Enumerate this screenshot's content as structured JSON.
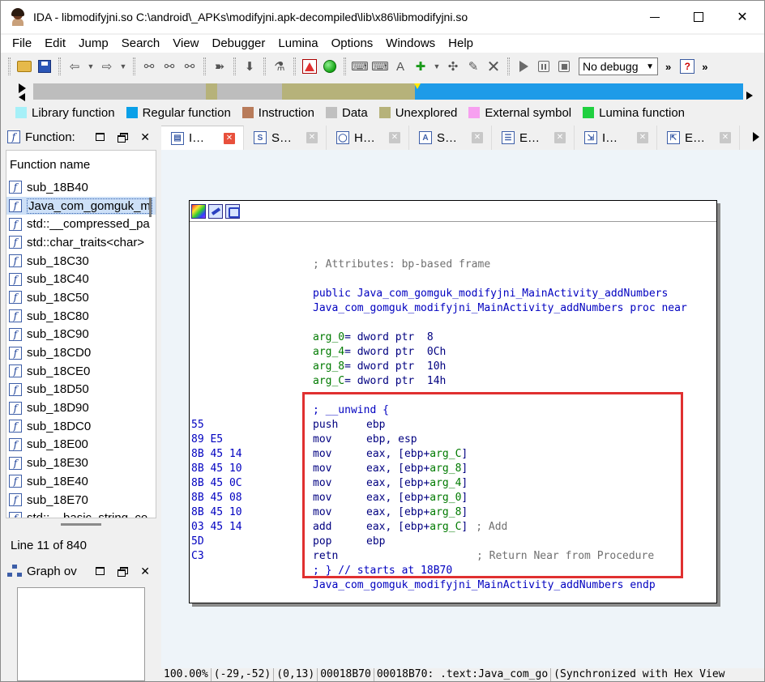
{
  "window": {
    "title": "IDA - libmodifyjni.so C:\\android\\_APKs\\modifyjni.apk-decompiled\\lib\\x86\\libmodifyjni.so",
    "controls": {
      "minimize": "",
      "maximize": "",
      "close": "✕"
    }
  },
  "menu": [
    "File",
    "Edit",
    "Jump",
    "Search",
    "View",
    "Debugger",
    "Lumina",
    "Options",
    "Windows",
    "Help"
  ],
  "toolbar": {
    "debugger_select": "No debugg",
    "more": "»"
  },
  "navband": {
    "colors": {
      "gray": "#bdbdbd",
      "olive": "#b6b27a",
      "blue": "#1e9be8"
    }
  },
  "legend": [
    {
      "label": "Library function",
      "color": "#a6f0f8"
    },
    {
      "label": "Regular function",
      "color": "#0aa0e8"
    },
    {
      "label": "Instruction",
      "color": "#b87b5a"
    },
    {
      "label": "Data",
      "color": "#c0c0c0"
    },
    {
      "label": "Unexplored",
      "color": "#b6b27a"
    },
    {
      "label": "External symbol",
      "color": "#f7a0f0"
    },
    {
      "label": "Lumina function",
      "color": "#20d040"
    }
  ],
  "functions_panel": {
    "title": "Function:",
    "column_header": "Function name",
    "items": [
      "sub_18B40",
      "Java_com_gomguk_m",
      "std::__compressed_pa",
      "std::char_traits<char>",
      "sub_18C30",
      "sub_18C40",
      "sub_18C50",
      "sub_18C80",
      "sub_18C90",
      "sub_18CD0",
      "sub_18CE0",
      "sub_18D50",
      "sub_18D90",
      "sub_18DC0",
      "sub_18E00",
      "sub_18E30",
      "sub_18E40",
      "sub_18E70",
      "std::__basic_string_co"
    ],
    "selected_index": 1,
    "line_info": "Line 11 of 840"
  },
  "graph_panel": {
    "title": "Graph ov"
  },
  "tabs": [
    {
      "label": "I…",
      "icon": "IDA",
      "active": true
    },
    {
      "label": "S…",
      "icon": "S",
      "active": false
    },
    {
      "label": "H…",
      "icon": "H",
      "active": false
    },
    {
      "label": "S…",
      "icon": "A",
      "active": false
    },
    {
      "label": "E…",
      "icon": "E",
      "active": false
    },
    {
      "label": "I…",
      "icon": "I",
      "active": false
    },
    {
      "label": "E…",
      "icon": "E",
      "active": false
    }
  ],
  "code": {
    "attributes_comment": "; Attributes: bp-based frame",
    "public_line": "public Java_com_gomguk_modifyjni_MainActivity_addNumbers",
    "proc_line": "Java_com_gomguk_modifyjni_MainActivity_addNumbers proc near",
    "args": [
      {
        "name": "arg_0",
        "def": "= dword ptr  8"
      },
      {
        "name": "arg_4",
        "def": "= dword ptr  0Ch"
      },
      {
        "name": "arg_8",
        "def": "= dword ptr  10h"
      },
      {
        "name": "arg_C",
        "def": "= dword ptr  14h"
      }
    ],
    "unwind_start": "; __unwind {",
    "instructions": [
      {
        "bytes": "55",
        "mnem": "push",
        "op1": "ebp",
        "arg": "",
        "tail": "",
        "comment": ""
      },
      {
        "bytes": "89 E5",
        "mnem": "mov",
        "op1": "ebp, esp",
        "arg": "",
        "tail": "",
        "comment": ""
      },
      {
        "bytes": "8B 45 14",
        "mnem": "mov",
        "op1": "eax, [ebp+",
        "arg": "arg_C",
        "tail": "]",
        "comment": ""
      },
      {
        "bytes": "8B 45 10",
        "mnem": "mov",
        "op1": "eax, [ebp+",
        "arg": "arg_8",
        "tail": "]",
        "comment": ""
      },
      {
        "bytes": "8B 45 0C",
        "mnem": "mov",
        "op1": "eax, [ebp+",
        "arg": "arg_4",
        "tail": "]",
        "comment": ""
      },
      {
        "bytes": "8B 45 08",
        "mnem": "mov",
        "op1": "eax, [ebp+",
        "arg": "arg_0",
        "tail": "]",
        "comment": ""
      },
      {
        "bytes": "8B 45 10",
        "mnem": "mov",
        "op1": "eax, [ebp+",
        "arg": "arg_8",
        "tail": "]",
        "comment": ""
      },
      {
        "bytes": "03 45 14",
        "mnem": "add",
        "op1": "eax, [ebp+",
        "arg": "arg_C",
        "tail": "]",
        "comment": "; Add"
      },
      {
        "bytes": "5D",
        "mnem": "pop",
        "op1": "ebp",
        "arg": "",
        "tail": "",
        "comment": ""
      },
      {
        "bytes": "C3",
        "mnem": "retn",
        "op1": "",
        "arg": "",
        "tail": "",
        "comment": "; Return Near from Procedure"
      }
    ],
    "unwind_end": "; } // starts at 18B70",
    "endp_line": "Java_com_gomguk_modifyjni_MainActivity_addNumbers endp"
  },
  "statusbar": [
    "100.00%",
    "(-29,-52)",
    "(0,13)",
    "00018B70",
    "00018B70: .text:Java_com_go",
    "(Synchronized with Hex View"
  ]
}
